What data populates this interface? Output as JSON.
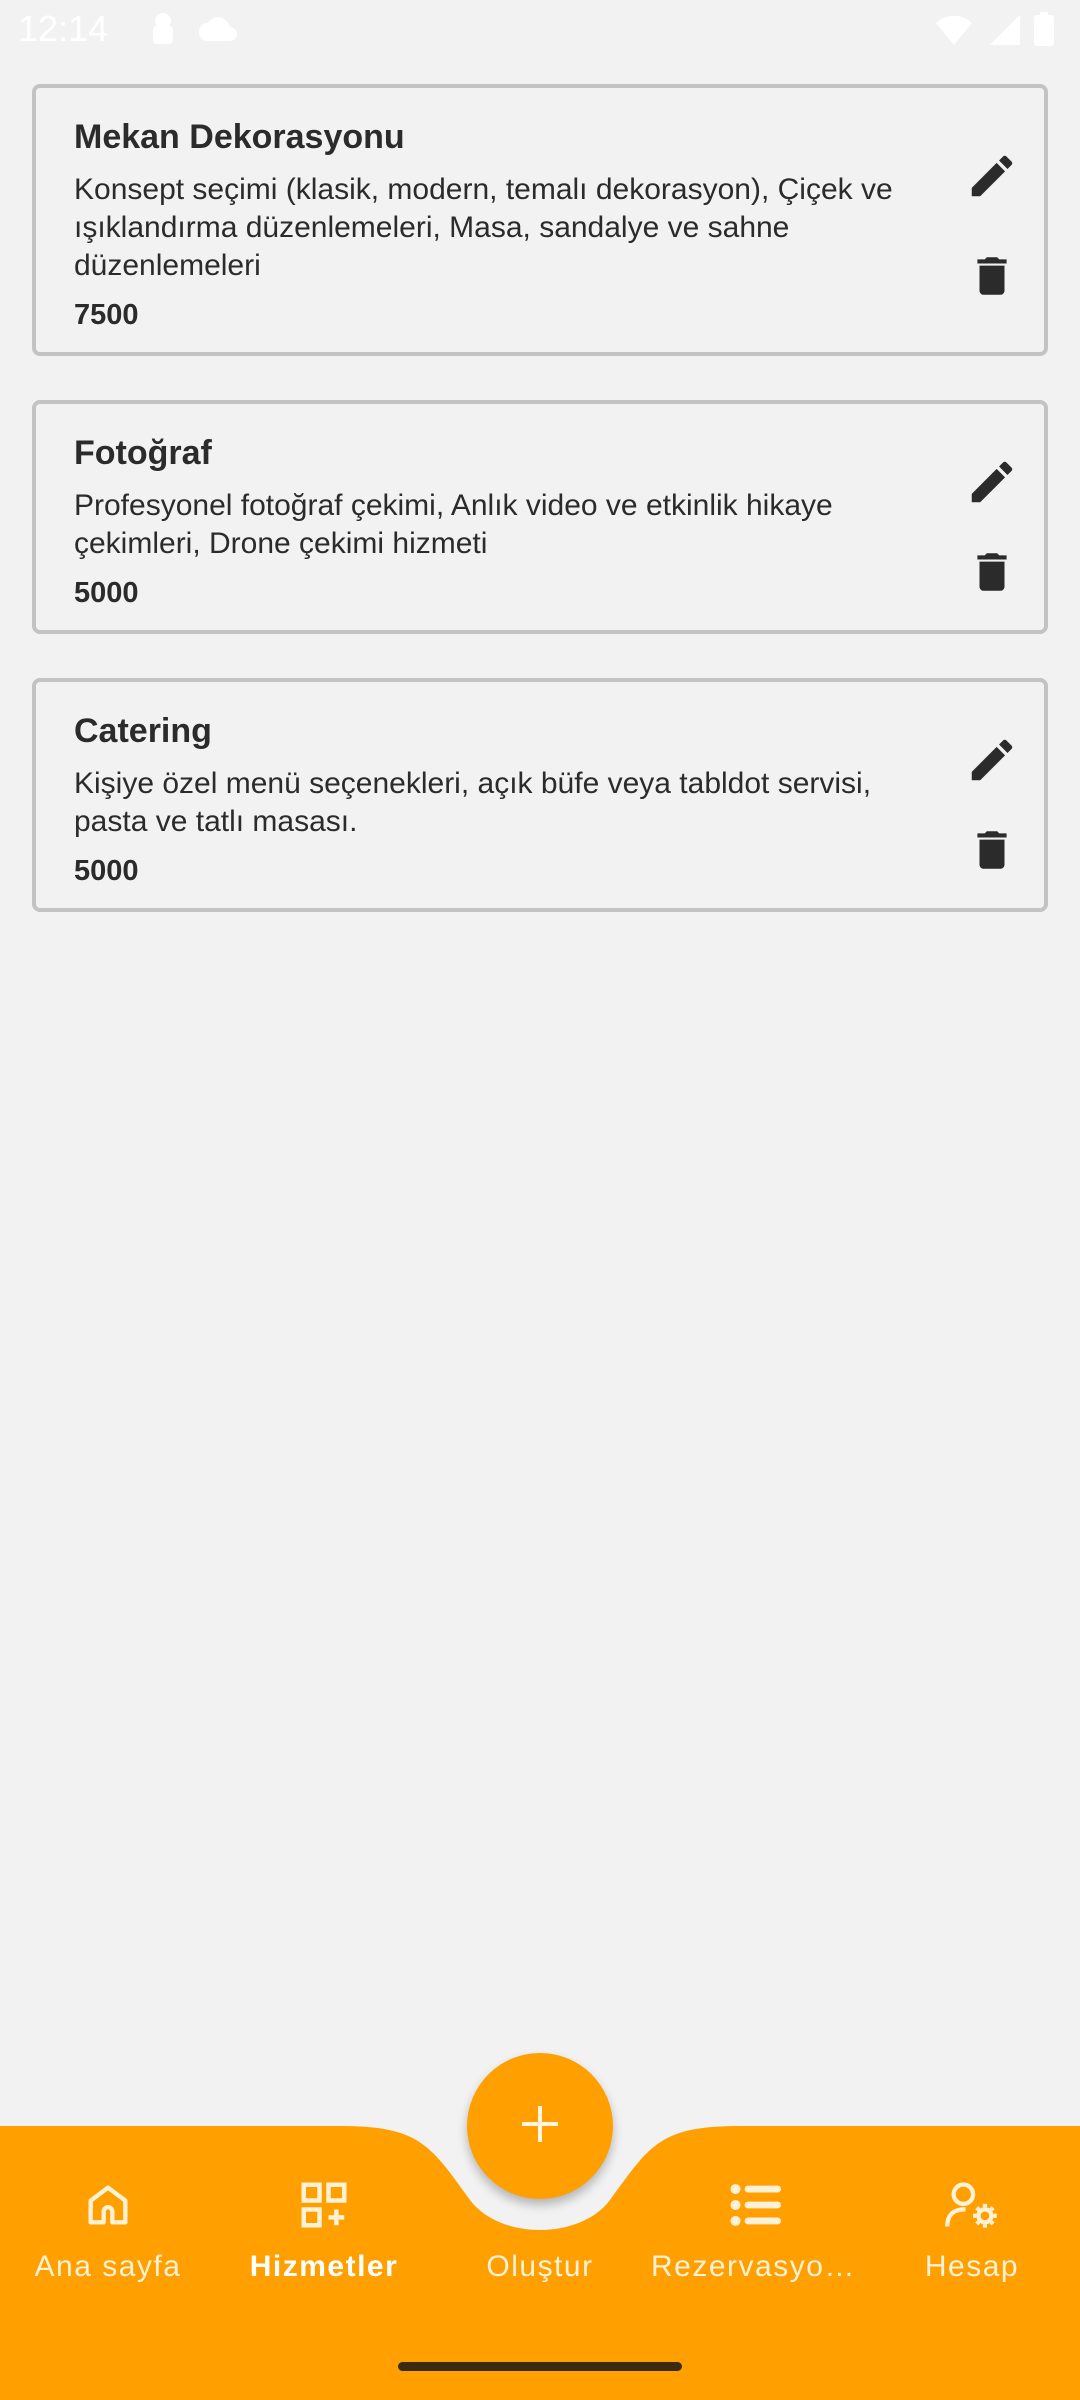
{
  "status_bar": {
    "time": "12:14",
    "icons": [
      "lock-icon",
      "cloud-icon",
      "wifi-icon",
      "signal-icon",
      "battery-icon"
    ]
  },
  "services": [
    {
      "title": "Mekan Dekorasyonu",
      "description": "Konsept seçimi (klasik, modern, temalı dekorasyon), Çiçek ve ışıklandırma düzenlemeleri, Masa, sandalye ve sahne düzenlemeleri",
      "price": "7500",
      "actions": [
        "edit-icon",
        "delete-icon"
      ]
    },
    {
      "title": "Fotoğraf",
      "description": "Profesyonel fotoğraf çekimi, Anlık video ve etkinlik hikaye çekimleri, Drone çekimi hizmeti",
      "price": "5000",
      "actions": [
        "edit-icon",
        "delete-icon"
      ]
    },
    {
      "title": "Catering",
      "description": "Kişiye özel menü seçenekleri, açık büfe veya tabldot servisi, pasta ve tatlı masası.",
      "price": "5000",
      "actions": [
        "edit-icon",
        "delete-icon"
      ]
    }
  ],
  "fab": {
    "icon": "plus-icon"
  },
  "bottom_nav": {
    "active": "Hizmetler",
    "items": [
      {
        "label": "Ana sayfa",
        "icon": "home-icon"
      },
      {
        "label": "Hizmetler",
        "icon": "services-grid-icon"
      },
      {
        "label": "Oluştur",
        "icon": ""
      },
      {
        "label": "Rezervasyonlar",
        "icon": "list-icon"
      },
      {
        "label": "Hesap",
        "icon": "user-settings-icon"
      }
    ]
  },
  "colors": {
    "accent": "#ffa000",
    "background": "#f2f2f2",
    "card_border": "#c3c3c3",
    "text": "#2b2b2b",
    "nav_text": "#ffffff"
  }
}
